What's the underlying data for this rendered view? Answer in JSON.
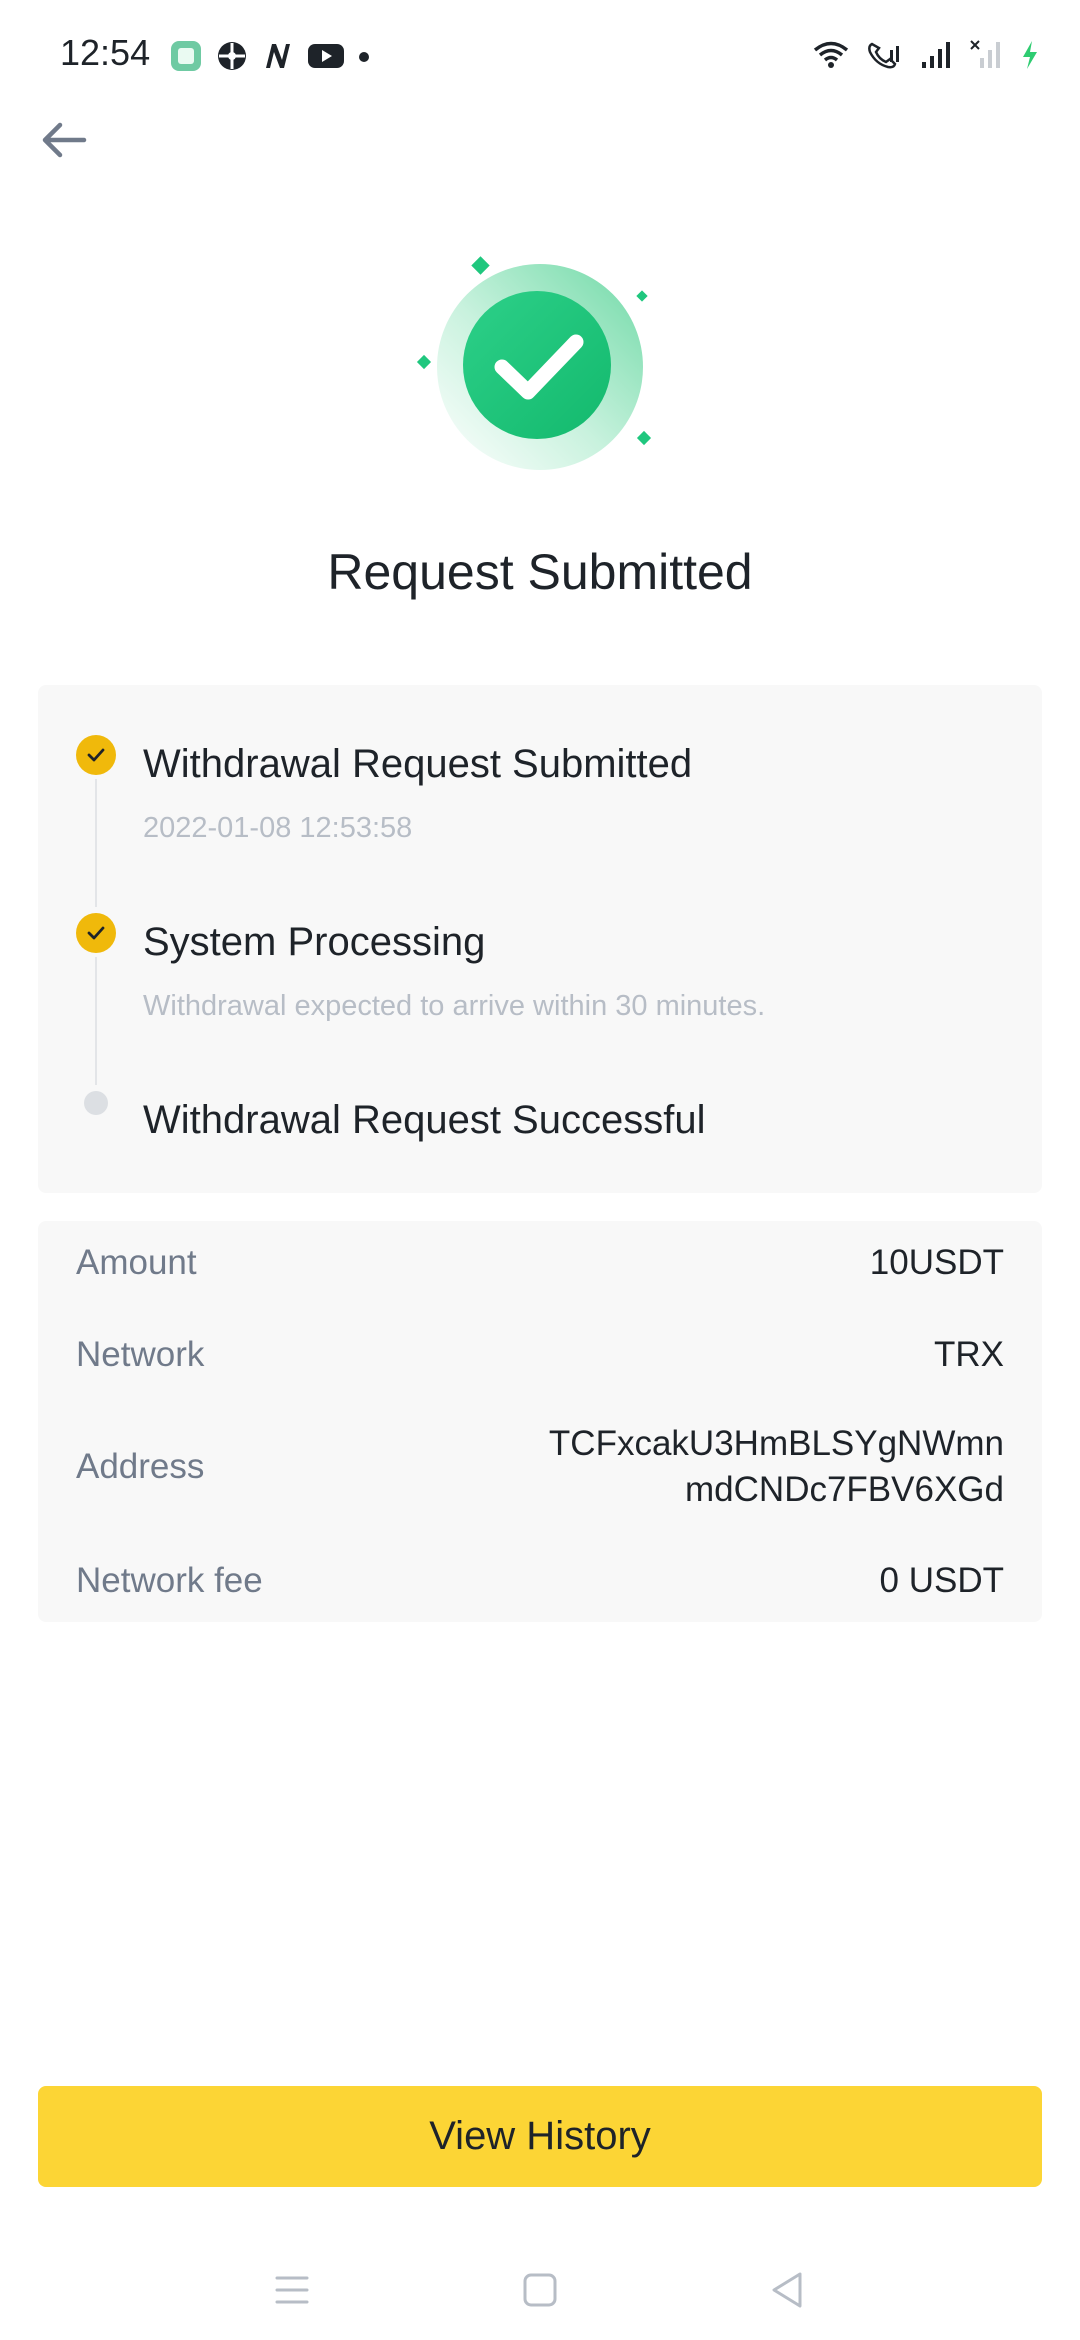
{
  "status_bar": {
    "time": "12:54",
    "notification_icons": [
      "gallery-app-icon",
      "soccer-ball-icon",
      "n-app-icon",
      "youtube-icon",
      "dot-icon"
    ],
    "system_icons": [
      "wifi-icon",
      "wifi-calling-icon",
      "signal-icon",
      "signal-no-sim-icon",
      "charging-icon"
    ]
  },
  "header": {
    "back_icon": "arrow-left-icon"
  },
  "hero": {
    "icon": "success-check-icon",
    "accent_color": "#1fc77e"
  },
  "page_title": "Request Submitted",
  "timeline": {
    "steps": [
      {
        "title": "Withdrawal Request Submitted",
        "subtitle": "2022-01-08 12:53:58",
        "status": "done"
      },
      {
        "title": "System Processing",
        "subtitle": "Withdrawal expected to arrive within 30 minutes.",
        "status": "done"
      },
      {
        "title": "Withdrawal Request Successful",
        "subtitle": "",
        "status": "pending"
      }
    ],
    "done_color": "#f0b90b"
  },
  "details": {
    "amount": {
      "label": "Amount",
      "value": "10USDT"
    },
    "network": {
      "label": "Network",
      "value": "TRX"
    },
    "address": {
      "label": "Address",
      "value_line1": "TCFxcakU3HmBLSYgNWmn",
      "value_line2": "mdCNDc7FBV6XGd"
    },
    "network_fee": {
      "label": "Network fee",
      "value": "0 USDT"
    }
  },
  "cta": {
    "label": "View History",
    "color": "#fcd535"
  },
  "nav_bar": {
    "items": [
      "menu-icon",
      "home-square-icon",
      "back-triangle-icon"
    ]
  }
}
